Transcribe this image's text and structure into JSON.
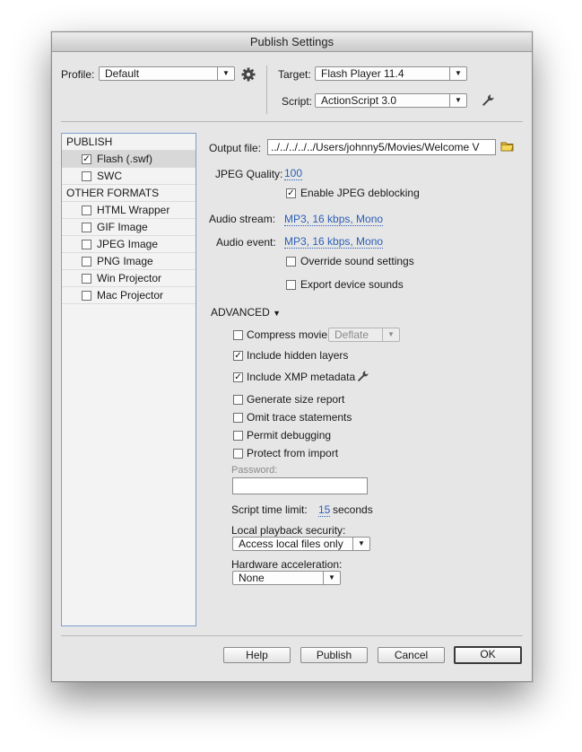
{
  "window": {
    "title": "Publish Settings"
  },
  "profile": {
    "label": "Profile:",
    "value": "Default"
  },
  "target": {
    "label": "Target:",
    "value": "Flash Player 11.4"
  },
  "script": {
    "label": "Script:",
    "value": "ActionScript 3.0"
  },
  "sidebar": {
    "publish_header": "PUBLISH",
    "other_header": "OTHER FORMATS",
    "items": [
      {
        "label": "Flash (.swf)",
        "checked": "✓"
      },
      {
        "label": "SWC",
        "checked": ""
      },
      {
        "label": "HTML Wrapper",
        "checked": ""
      },
      {
        "label": "GIF Image",
        "checked": ""
      },
      {
        "label": "JPEG Image",
        "checked": ""
      },
      {
        "label": "PNG Image",
        "checked": ""
      },
      {
        "label": "Win Projector",
        "checked": ""
      },
      {
        "label": "Mac Projector",
        "checked": ""
      }
    ]
  },
  "output": {
    "label": "Output file:",
    "value": "../../../../../Users/johnny5/Movies/Welcome V"
  },
  "jpeg": {
    "label": "JPEG Quality:",
    "value": "100",
    "deblock_label": "Enable JPEG deblocking",
    "deblock_checked": "✓"
  },
  "audio": {
    "stream_label": "Audio stream:",
    "stream_value": "MP3, 16 kbps, Mono",
    "event_label": "Audio event:",
    "event_value": "MP3, 16 kbps, Mono",
    "override_label": "Override sound settings",
    "override_checked": "",
    "export_label": "Export device sounds",
    "export_checked": ""
  },
  "advanced": {
    "header": "ADVANCED",
    "compress": {
      "label": "Compress movie",
      "checked": "",
      "value": "Deflate"
    },
    "hidden_layers": {
      "label": "Include hidden layers",
      "checked": "✓"
    },
    "xmp": {
      "label": "Include XMP metadata",
      "checked": "✓"
    },
    "size_report": {
      "label": "Generate size report",
      "checked": ""
    },
    "omit_trace": {
      "label": "Omit trace statements",
      "checked": ""
    },
    "permit_debug": {
      "label": "Permit debugging",
      "checked": ""
    },
    "protect": {
      "label": "Protect from import",
      "checked": ""
    },
    "password_label": "Password:",
    "password_value": "",
    "script_time_label": "Script time limit:",
    "script_time_value": "15",
    "script_time_unit": "seconds",
    "local_security_label": "Local playback security:",
    "local_security_value": "Access local files only",
    "hw_accel_label": "Hardware acceleration:",
    "hw_accel_value": "None"
  },
  "buttons": {
    "help": "Help",
    "publish": "Publish",
    "cancel": "Cancel",
    "ok": "OK"
  },
  "colors": {
    "link": "#2c5fb5",
    "sidebar_border": "#7d9fcc",
    "folder": "#e8c23a"
  }
}
